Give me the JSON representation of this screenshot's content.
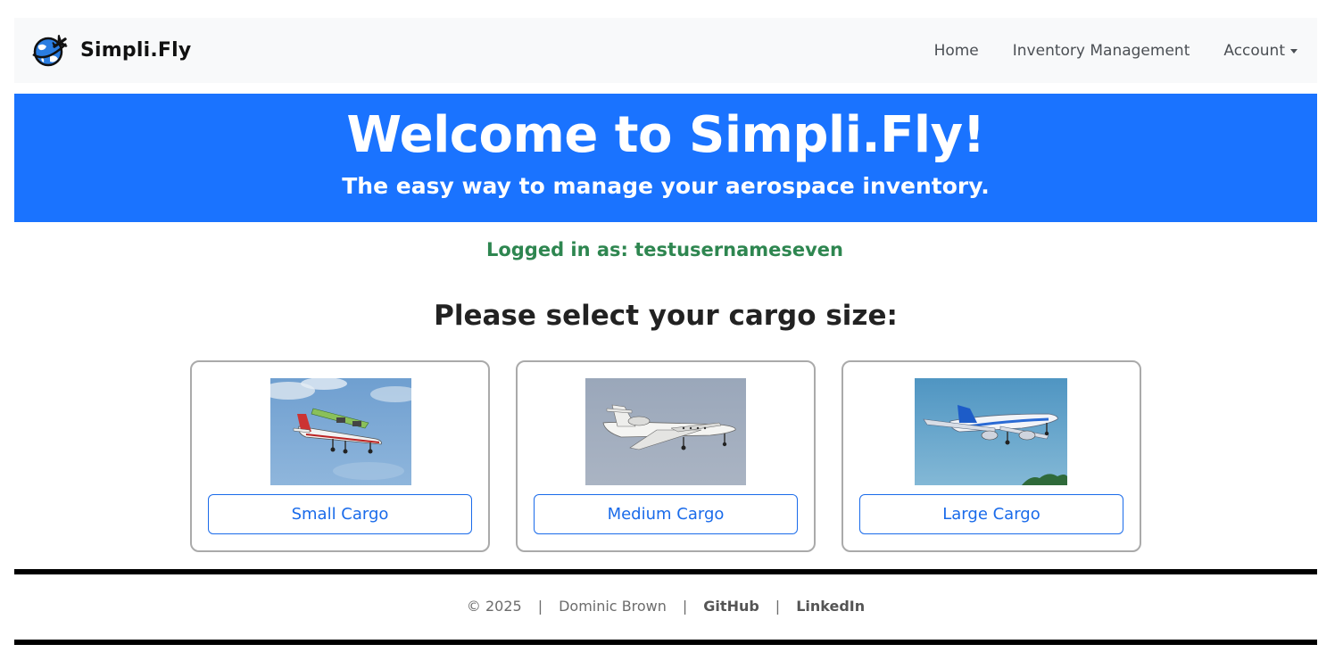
{
  "navbar": {
    "brand": "Simpli.Fly",
    "links": {
      "home": "Home",
      "inventory": "Inventory Management",
      "account": "Account"
    }
  },
  "hero": {
    "title": "Welcome to Simpli.Fly!",
    "subtitle": "The easy way to manage your aerospace inventory."
  },
  "status": {
    "logged_in": "Logged in as: testusernameseven"
  },
  "cargo": {
    "prompt": "Please select your cargo size:",
    "options": [
      {
        "label": "Small Cargo"
      },
      {
        "label": "Medium Cargo"
      },
      {
        "label": "Large Cargo"
      }
    ]
  },
  "footer": {
    "copyright": "© 2025",
    "author": "Dominic Brown",
    "github": "GitHub",
    "linkedin": "LinkedIn",
    "separator": "|"
  },
  "colors": {
    "hero_bg": "#1a73ff",
    "navbar_bg": "#f8f9fa",
    "logged_in_text": "#2e8650",
    "button_accent": "#1a6bea"
  }
}
